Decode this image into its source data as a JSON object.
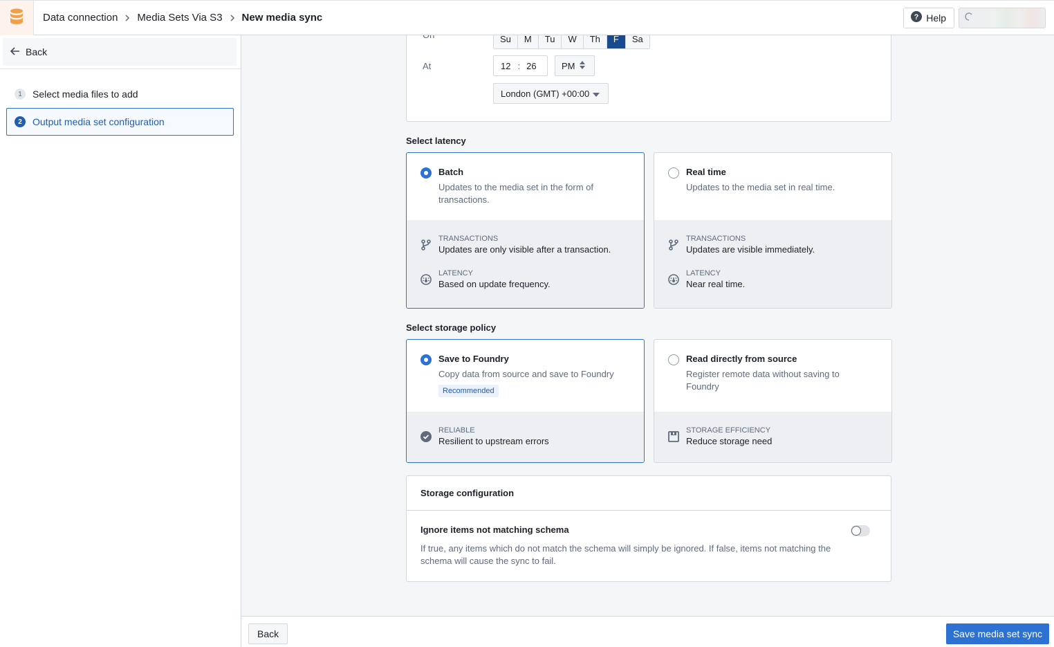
{
  "header": {
    "app_icon": "database-icon",
    "breadcrumbs": [
      "Data connection",
      "Media Sets Via S3",
      "New media sync"
    ],
    "help_label": "Help"
  },
  "sidebar": {
    "back_label": "Back",
    "steps": [
      {
        "number": "1",
        "label": "Select media files to add",
        "active": false
      },
      {
        "number": "2",
        "label": "Output media set configuration",
        "active": true
      }
    ]
  },
  "schedule": {
    "on_label": "On",
    "days": [
      "Su",
      "M",
      "Tu",
      "W",
      "Th",
      "F",
      "Sa"
    ],
    "selected_day": "F",
    "at_label": "At",
    "hour": "12",
    "separator": ":",
    "minute": "26",
    "ampm": "PM",
    "timezone": "London (GMT) +00:00"
  },
  "latency": {
    "title": "Select latency",
    "options": [
      {
        "title": "Batch",
        "description": "Updates to the media set in the form of transactions.",
        "selected": true,
        "features": [
          {
            "icon": "git-branch-icon",
            "label": "TRANSACTIONS",
            "value": "Updates are only visible after a transaction."
          },
          {
            "icon": "dashboard-icon",
            "label": "LATENCY",
            "value": "Based on update frequency."
          }
        ]
      },
      {
        "title": "Real time",
        "description": "Updates to the media set in real time.",
        "selected": false,
        "features": [
          {
            "icon": "git-branch-icon",
            "label": "TRANSACTIONS",
            "value": "Updates are visible immediately."
          },
          {
            "icon": "dashboard-icon",
            "label": "LATENCY",
            "value": "Near real time."
          }
        ]
      }
    ]
  },
  "storage_policy": {
    "title": "Select storage policy",
    "options": [
      {
        "title": "Save to Foundry",
        "description": "Copy data from source and save to Foundry",
        "tag": "Recommended",
        "selected": true,
        "features": [
          {
            "icon": "tick-circle-icon",
            "label": "RELIABLE",
            "value": "Resilient to upstream errors"
          }
        ]
      },
      {
        "title": "Read directly from source",
        "description": "Register remote data without saving to Foundry",
        "selected": false,
        "features": [
          {
            "icon": "floppy-disk-icon",
            "label": "STORAGE EFFICIENCY",
            "value": "Reduce storage need"
          }
        ]
      }
    ]
  },
  "storage_config": {
    "title": "Storage configuration",
    "setting_title": "Ignore items not matching schema",
    "setting_description": "If true, any items which do not match the schema will simply be ignored. If false, items not matching the schema will cause the sync to fail.",
    "enabled": false
  },
  "footer": {
    "back_label": "Back",
    "save_label": "Save media set sync"
  },
  "colors": {
    "primary": "#2d72d2",
    "selected_day": "#184a90",
    "app_icon": "#f0a04b"
  }
}
